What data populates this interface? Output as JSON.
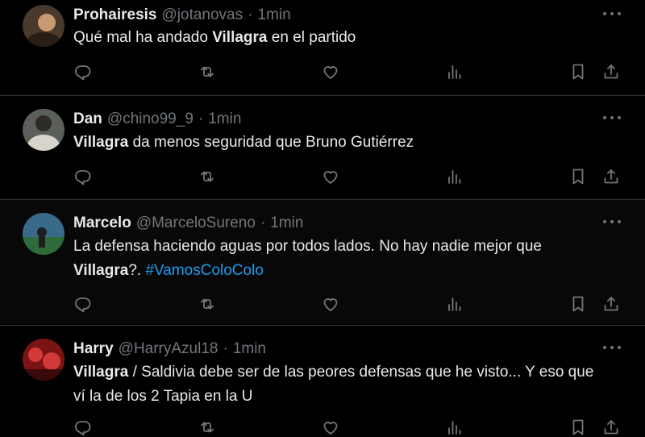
{
  "tweets": [
    {
      "name": "Prohairesis",
      "handle": "@jotanovas",
      "sep": "·",
      "time": "1min",
      "segments": [
        {
          "text": "Qué mal ha andado ",
          "style": "normal"
        },
        {
          "text": "Villagra",
          "style": "bold"
        },
        {
          "text": " en el partido",
          "style": "normal"
        }
      ],
      "avatar": {
        "bg": "#4a3a2c",
        "fg": "#c99a70"
      }
    },
    {
      "name": "Dan",
      "handle": "@chino99_9",
      "sep": "·",
      "time": "1min",
      "segments": [
        {
          "text": "Villagra",
          "style": "bold"
        },
        {
          "text": " da menos seguridad que Bruno Gutiérrez",
          "style": "normal"
        }
      ],
      "avatar": {
        "bg": "#5b5f5a",
        "fg": "#d8d4cc"
      }
    },
    {
      "name": "Marcelo",
      "handle": "@MarceloSureno",
      "sep": "·",
      "time": "1min",
      "segments": [
        {
          "text": "La defensa haciendo aguas por todos lados. No hay nadie mejor que",
          "style": "normal"
        },
        {
          "text": "Villagra",
          "style": "bold",
          "newline": true
        },
        {
          "text": "?. ",
          "style": "normal"
        },
        {
          "text": "#VamosColoColo",
          "style": "hashtag"
        }
      ],
      "avatar": {
        "bg": "#3a6a8a",
        "fg": "#2f6b3a"
      }
    },
    {
      "name": "Harry",
      "handle": "@HarryAzul18",
      "sep": "·",
      "time": "1min",
      "segments": [
        {
          "text": "Villagra",
          "style": "bold"
        },
        {
          "text": " / Saldivia debe ser de las peores defensas que he visto... Y eso que",
          "style": "normal"
        },
        {
          "text": "ví la de los 2 Tapia en la U",
          "style": "normal",
          "newline": true
        }
      ],
      "avatar": {
        "bg": "#7a1414",
        "fg": "#d23a3a"
      }
    }
  ],
  "action_icons": [
    "reply-icon",
    "retweet-icon",
    "like-icon",
    "views-icon",
    "bookmark-icon",
    "share-icon"
  ],
  "more_icon": "more-icon",
  "colors": {
    "background": "#000000",
    "hover_background": "#080808",
    "text": "#e7e9ea",
    "muted": "#71767b",
    "hashtag": "#1d9bf0",
    "border": "#2f3336"
  }
}
